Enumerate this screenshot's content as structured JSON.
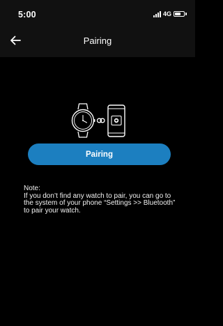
{
  "status_bar": {
    "time": "5:00",
    "network": "4G",
    "battery_level": 0.7,
    "icons": [
      "signal-icon",
      "battery-icon"
    ]
  },
  "header": {
    "back_icon": "arrow-left-icon",
    "title": "Pairing"
  },
  "illustration": {
    "icons": [
      "watch-icon",
      "link-icon",
      "phone-icon",
      "heart-icon"
    ]
  },
  "main": {
    "pairing_button_label": "Pairing",
    "note_label": "Note:",
    "note_text": "If you don’t find any watch to pair, you can go to the system of your phone “Settings >> Bluetooth” to pair your watch."
  },
  "colors": {
    "background": "#000000",
    "bar_background": "#111111",
    "accent": "#1c7fc0",
    "text": "#ffffff"
  }
}
